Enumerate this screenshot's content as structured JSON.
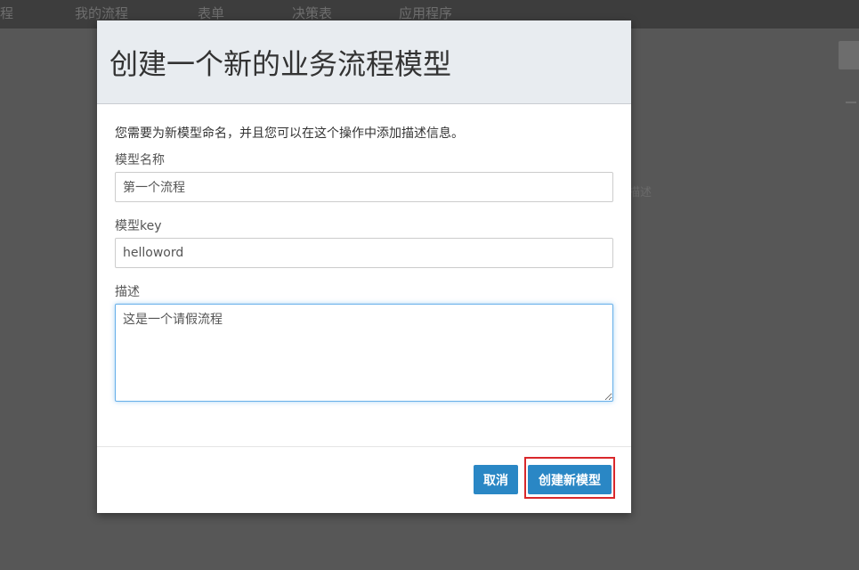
{
  "background": {
    "nav_items": [
      "程",
      "我的流程",
      "表单",
      "决策表",
      "应用程序"
    ],
    "faint_text": "描述"
  },
  "modal": {
    "title": "创建一个新的业务流程模型",
    "intro": "您需要为新模型命名，并且您可以在这个操作中添加描述信息。",
    "fields": {
      "name": {
        "label": "模型名称",
        "value": "第一个流程"
      },
      "key": {
        "label": "模型key",
        "value": "helloword"
      },
      "description": {
        "label": "描述",
        "value": "这是一个请假流程"
      }
    },
    "buttons": {
      "cancel_label": "取消",
      "create_label": "创建新模型"
    }
  },
  "colors": {
    "primary_button": "#2a87c5",
    "highlight_border": "#d9282b",
    "focus_border": "#66afe9"
  }
}
